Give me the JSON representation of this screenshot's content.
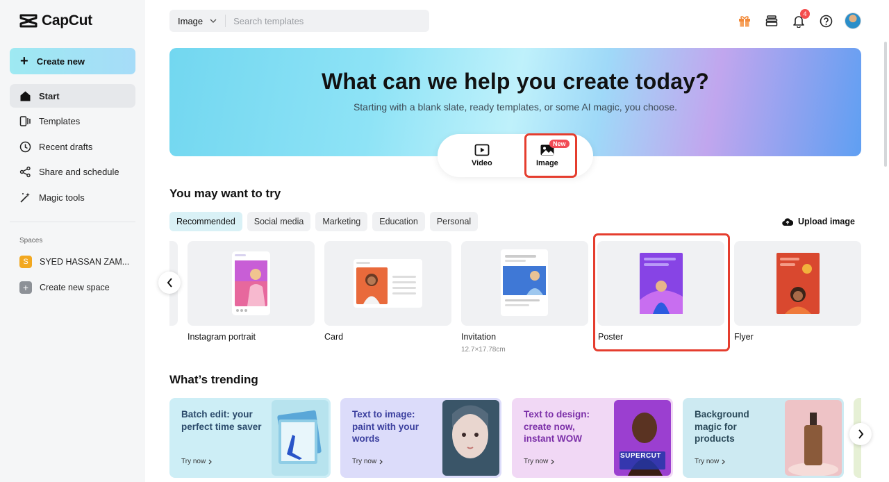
{
  "app": {
    "brand": "CapCut"
  },
  "sidebar": {
    "create_new": "Create new",
    "items": [
      {
        "label": "Start",
        "icon": "home-icon"
      },
      {
        "label": "Templates",
        "icon": "templates-icon"
      },
      {
        "label": "Recent drafts",
        "icon": "clock-icon"
      },
      {
        "label": "Share and schedule",
        "icon": "share-icon"
      },
      {
        "label": "Magic tools",
        "icon": "magic-wand-icon"
      }
    ],
    "spaces_label": "Spaces",
    "space_name": "SYED HASSAN ZAM...",
    "space_initial": "S",
    "create_space": "Create new space"
  },
  "topbar": {
    "search_type": "Image",
    "search_placeholder": "Search templates",
    "notification_count": "4"
  },
  "hero": {
    "title": "What can we help you create today?",
    "subtitle": "Starting with a blank slate, ready templates, or some AI magic, you choose.",
    "options": [
      {
        "label": "Video"
      },
      {
        "label": "Image",
        "badge": "New"
      }
    ]
  },
  "try_section": {
    "title": "You may want to try",
    "chips": [
      "Recommended",
      "Social media",
      "Marketing",
      "Education",
      "Personal"
    ],
    "upload_label": "Upload image",
    "templates": [
      {
        "name": "Instagram portrait",
        "sub": ""
      },
      {
        "name": "Card",
        "sub": ""
      },
      {
        "name": "Invitation",
        "sub": "12.7×17.78cm"
      },
      {
        "name": "Poster",
        "sub": ""
      },
      {
        "name": "Flyer",
        "sub": ""
      }
    ]
  },
  "trending": {
    "title": "What’s trending",
    "try_label": "Try now",
    "cards": [
      {
        "title": "Batch edit: your perfect time saver",
        "color": "#2b4a6b",
        "bg": "#cdeef6"
      },
      {
        "title": "Text to image: paint with your words",
        "color": "#3b3f9e",
        "bg": "#dcdcfa"
      },
      {
        "title": "Text to design: create now, instant WOW",
        "color": "#7b2fa8",
        "bg": "#f1d8f5"
      },
      {
        "title": "Background magic for products",
        "color": "#2b4a5a",
        "bg": "#cdeaf2"
      }
    ],
    "supercut_text": "SUPERCUT"
  },
  "colors": {
    "accent": "#9ee9f2",
    "highlight": "#e53d2e",
    "badge": "#f24a55"
  }
}
